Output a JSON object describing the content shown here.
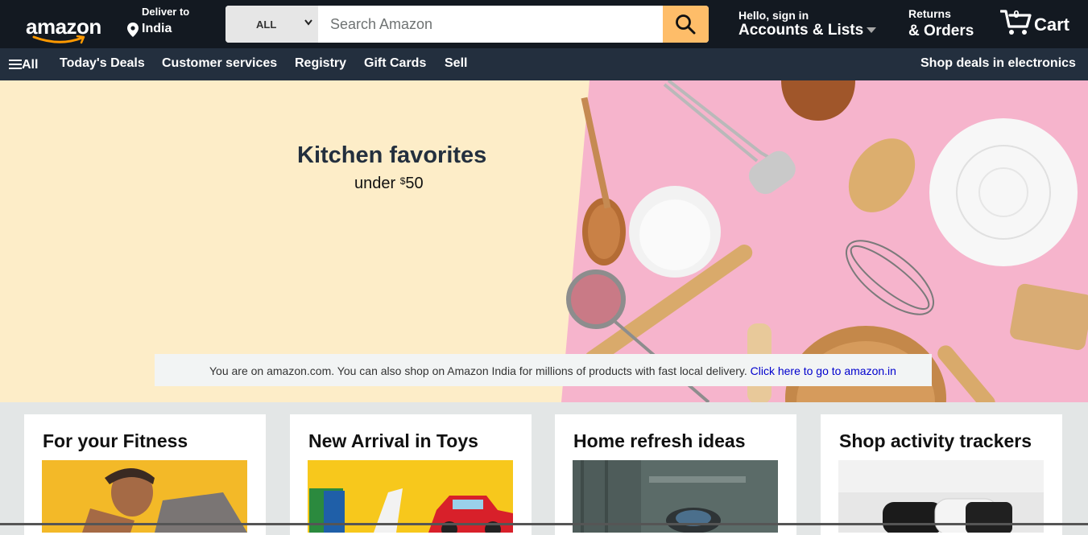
{
  "header": {
    "logo_text": "amazon",
    "deliver_to_label": "Deliver to",
    "deliver_to_location": "India",
    "search": {
      "category": "ALL",
      "placeholder": "Search Amazon"
    },
    "account_greeting": "Hello, sign in",
    "account_label": "Accounts & Lists",
    "returns_label": "Returns",
    "orders_label": "& Orders",
    "cart_label": "Cart",
    "cart_count": "0"
  },
  "subnav": {
    "all_label": "All",
    "items": [
      "Today's Deals",
      "Customer services",
      "Registry",
      "Gift Cards",
      "Sell"
    ],
    "promo": "Shop deals in electronics"
  },
  "hero": {
    "title": "Kitchen favorites",
    "subtitle_prefix": "under",
    "subtitle_currency": "$",
    "subtitle_amount": "50"
  },
  "notice": {
    "text": "You are on amazon.com. You can also shop on Amazon India for millions of products with fast local delivery.",
    "link": "Click here to go to amazon.in"
  },
  "cards": [
    {
      "title": "For your Fitness"
    },
    {
      "title": "New Arrival in Toys"
    },
    {
      "title": "Home refresh ideas"
    },
    {
      "title": "Shop activity trackers"
    }
  ],
  "colors": {
    "header_bg": "#131921",
    "subnav_bg": "#232f3e",
    "search_button": "#febd69",
    "hero_left_bg": "#fdedc8",
    "hero_right_bg": "#f6b4cc",
    "page_bg": "#e3e6e6",
    "link": "#0000cd"
  }
}
